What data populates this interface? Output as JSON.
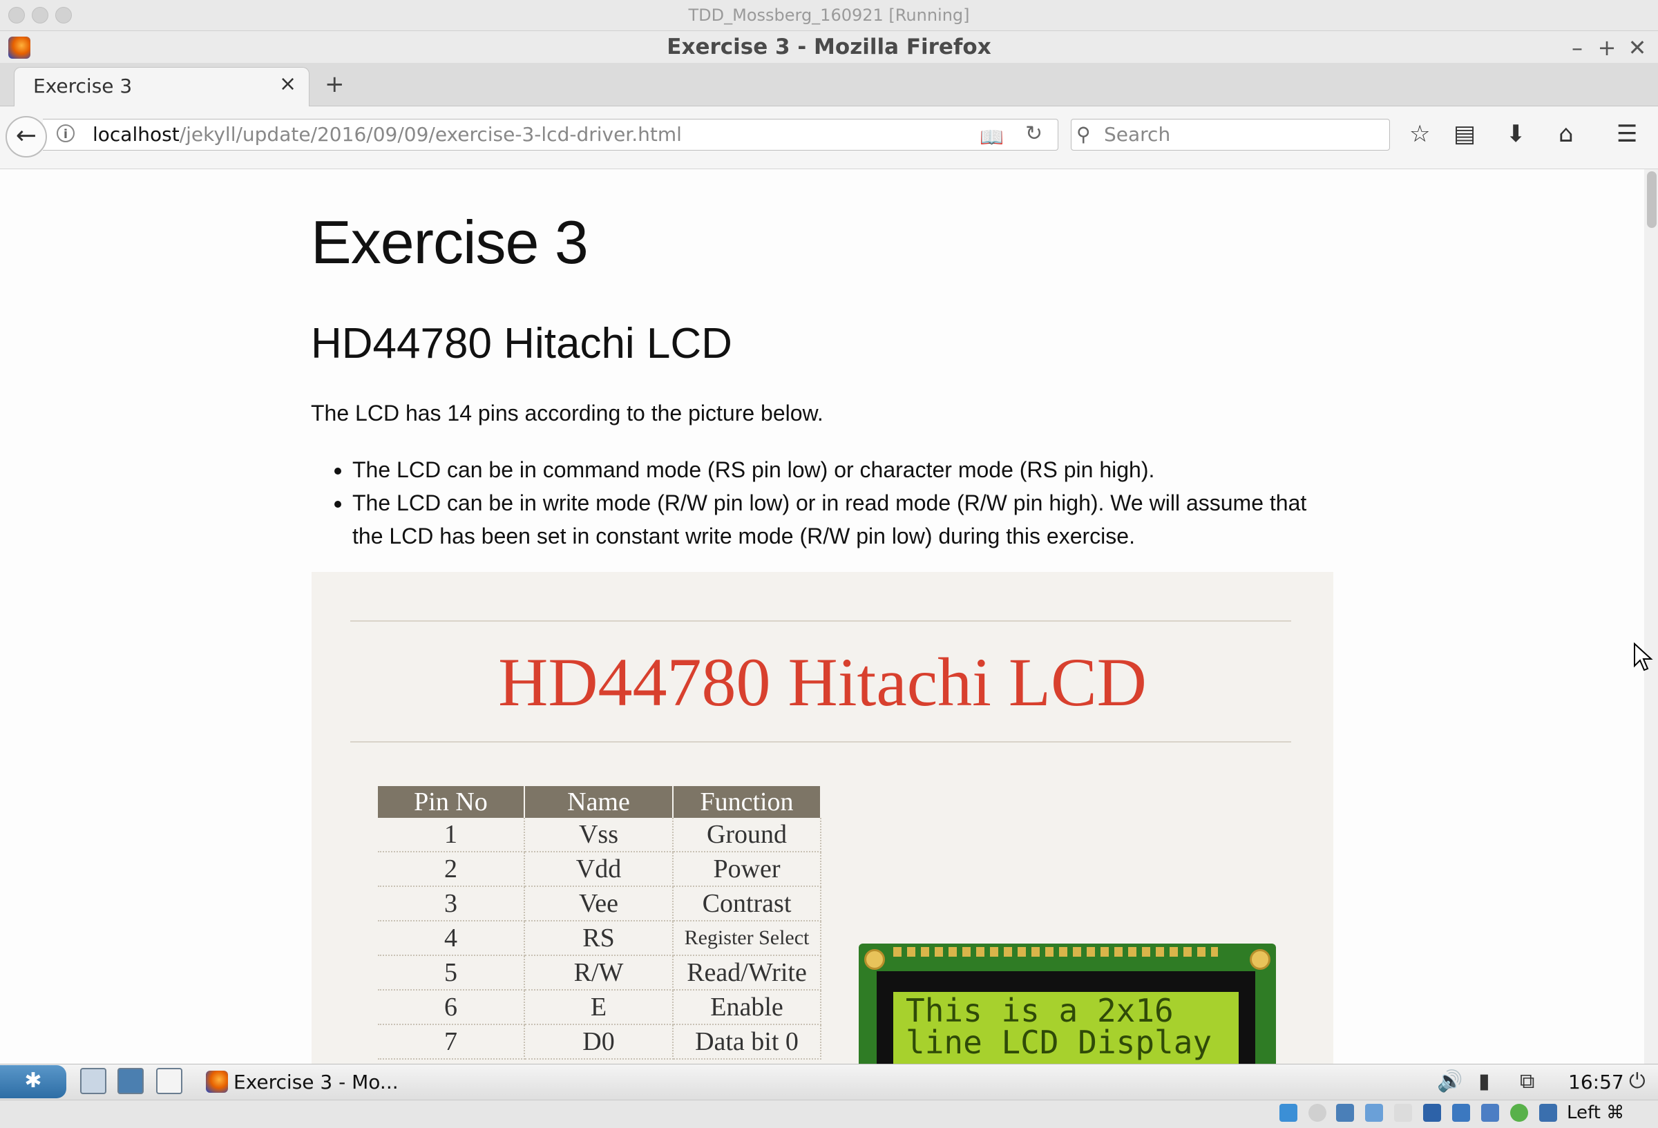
{
  "host": {
    "title": "TDD_Mossberg_160921 [Running]"
  },
  "firefox": {
    "window_title": "Exercise 3 - Mozilla Firefox",
    "controls": {
      "minimize": "–",
      "maximize": "+",
      "close": "✕"
    },
    "tab": {
      "label": "Exercise 3",
      "close": "×",
      "new_tab": "+"
    },
    "url": {
      "host": "localhost",
      "path": "/jekyll/update/2016/09/09/exercise-3-lcd-driver.html"
    },
    "search": {
      "placeholder": "Search"
    },
    "toolbar_icons": [
      "star-icon",
      "clipboard-icon",
      "download-icon",
      "home-icon",
      "menu-icon"
    ]
  },
  "page": {
    "h1": "Exercise 3",
    "h2": "HD44780 Hitachi LCD",
    "intro": "The LCD has 14 pins according to the picture below.",
    "bullets": [
      "The LCD can be in command mode (RS pin low) or character mode (RS pin high).",
      "The LCD can be in write mode (R/W pin low) or in read mode (R/W pin high). We will assume that the LCD has been set in constant write mode (R/W pin low) during this exercise."
    ],
    "figure": {
      "title": "HD44780 Hitachi LCD",
      "headers": [
        "Pin No",
        "Name",
        "Function"
      ],
      "rows": [
        [
          "1",
          "Vss",
          "Ground"
        ],
        [
          "2",
          "Vdd",
          "Power"
        ],
        [
          "3",
          "Vee",
          "Contrast"
        ],
        [
          "4",
          "RS",
          "Register Select"
        ],
        [
          "5",
          "R/W",
          "Read/Write"
        ],
        [
          "6",
          "E",
          "Enable"
        ],
        [
          "7",
          "D0",
          "Data bit 0"
        ]
      ],
      "lcd_text": "This is a 2x16\nline LCD Display",
      "colors": {
        "title": "#d8402e",
        "header_bg": "#7d7566",
        "lcd_screen": "#a7d12d",
        "pcb": "#2f7c25"
      }
    }
  },
  "taskbar": {
    "task_label": "Exercise 3 - Mo...",
    "clock": "16:57"
  },
  "vbox_status": {
    "host_key": "Left ⌘"
  }
}
